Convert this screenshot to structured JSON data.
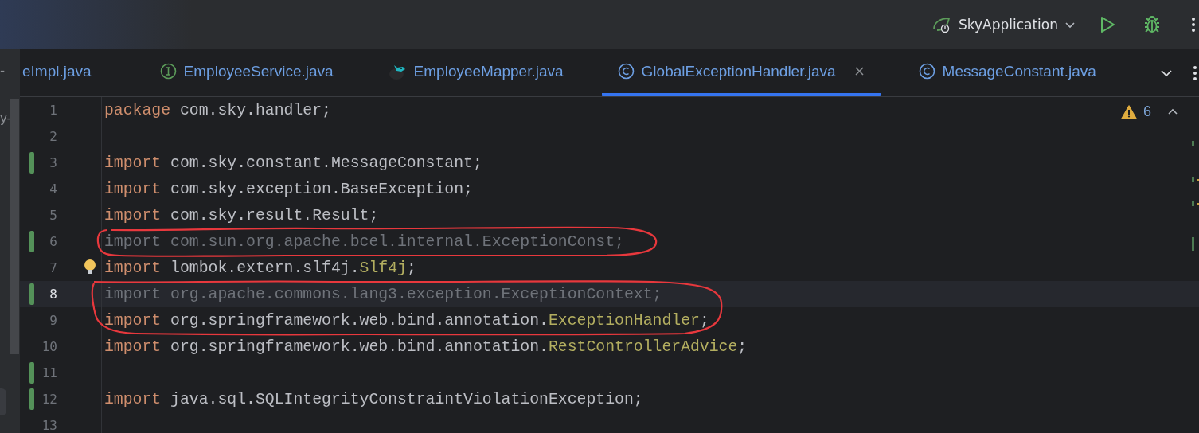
{
  "toolbar": {
    "run_config": "SkyApplication"
  },
  "project_panel": {
    "fragments": [
      "-",
      "y-"
    ]
  },
  "tabs": [
    {
      "label": "eImpl.java",
      "kind": "plain",
      "selected": false
    },
    {
      "label": "EmployeeService.java",
      "kind": "interface",
      "selected": false
    },
    {
      "label": "EmployeeMapper.java",
      "kind": "mapper",
      "selected": false
    },
    {
      "label": "GlobalExceptionHandler.java",
      "kind": "class",
      "selected": true
    },
    {
      "label": "MessageConstant.java",
      "kind": "class",
      "selected": false
    }
  ],
  "editor": {
    "warnings": "6",
    "lines": [
      {
        "number": "1",
        "changed": false,
        "current": false,
        "bulb": false,
        "tokens": [
          {
            "kind": "keyword",
            "text": "package"
          },
          {
            "kind": "plain",
            "text": " com.sky.handler;"
          }
        ]
      },
      {
        "number": "2",
        "changed": false,
        "current": false,
        "bulb": false
      },
      {
        "number": "3",
        "changed": true,
        "current": false,
        "bulb": false,
        "tokens": [
          {
            "kind": "keyword",
            "text": "import"
          },
          {
            "kind": "plain",
            "text": " com.sky.constant.MessageConstant;"
          }
        ]
      },
      {
        "number": "4",
        "changed": false,
        "current": false,
        "bulb": false,
        "tokens": [
          {
            "kind": "keyword",
            "text": "import"
          },
          {
            "kind": "plain",
            "text": " com.sky.exception.BaseException;"
          }
        ]
      },
      {
        "number": "5",
        "changed": false,
        "current": false,
        "bulb": false,
        "tokens": [
          {
            "kind": "keyword",
            "text": "import"
          },
          {
            "kind": "plain",
            "text": " com.sky.result.Result;"
          }
        ]
      },
      {
        "number": "6",
        "changed": true,
        "current": false,
        "bulb": false,
        "tokens": [
          {
            "kind": "unused",
            "text": "import com.sun.org.apache.bcel.internal.ExceptionConst;"
          }
        ]
      },
      {
        "number": "7",
        "changed": false,
        "current": false,
        "bulb": true,
        "tokens": [
          {
            "kind": "keyword",
            "text": "import"
          },
          {
            "kind": "plain",
            "text": " lombok.extern.slf4j."
          },
          {
            "kind": "annotation",
            "text": "Slf4j"
          },
          {
            "kind": "plain",
            "text": ";"
          }
        ]
      },
      {
        "number": "8",
        "changed": true,
        "current": true,
        "bulb": false,
        "tokens": [
          {
            "kind": "unused",
            "text": "import org.apache.commons.lang3.exception.ExceptionContext;"
          }
        ]
      },
      {
        "number": "9",
        "changed": false,
        "current": false,
        "bulb": false,
        "tokens": [
          {
            "kind": "keyword",
            "text": "import"
          },
          {
            "kind": "plain",
            "text": " org.springframework.web.bind.annotation."
          },
          {
            "kind": "annotation",
            "text": "ExceptionHandler"
          },
          {
            "kind": "plain",
            "text": ";"
          }
        ]
      },
      {
        "number": "10",
        "changed": false,
        "current": false,
        "bulb": false,
        "tokens": [
          {
            "kind": "keyword",
            "text": "import"
          },
          {
            "kind": "plain",
            "text": " org.springframework.web.bind.annotation."
          },
          {
            "kind": "annotation",
            "text": "RestControllerAdvice"
          },
          {
            "kind": "plain",
            "text": ";"
          }
        ]
      },
      {
        "number": "11",
        "changed": true,
        "current": false,
        "bulb": false
      },
      {
        "number": "12",
        "changed": true,
        "current": false,
        "bulb": false,
        "tokens": [
          {
            "kind": "keyword",
            "text": "import"
          },
          {
            "kind": "plain",
            "text": " java.sql.SQLIntegrityConstraintViolationException;"
          }
        ]
      },
      {
        "number": "13",
        "changed": false,
        "current": false,
        "bulb": false
      }
    ]
  }
}
